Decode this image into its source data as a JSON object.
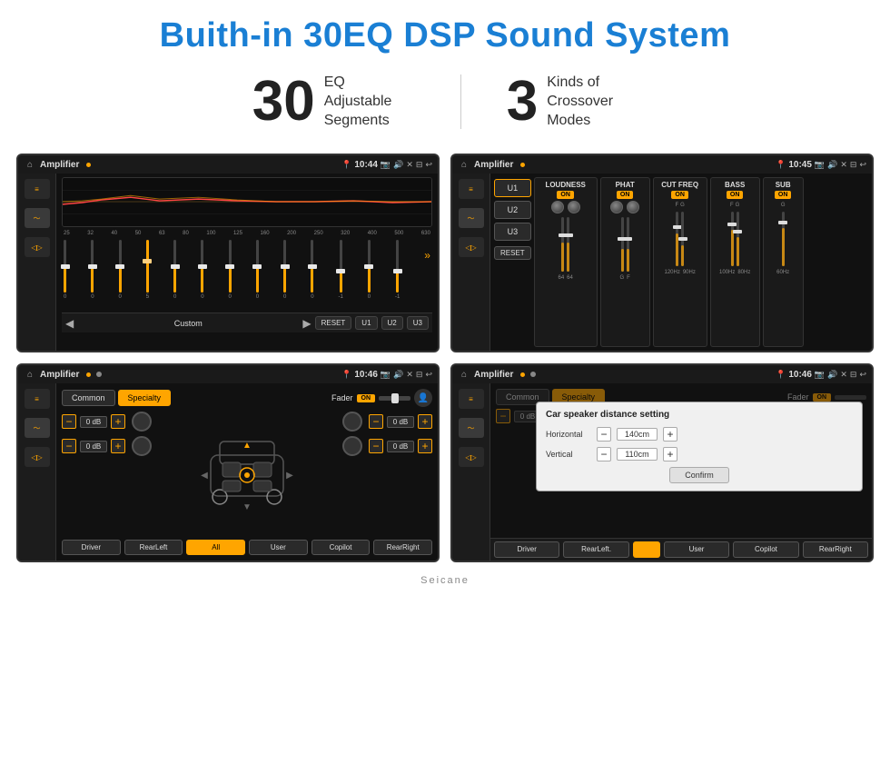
{
  "header": {
    "title": "Buith-in 30EQ DSP Sound System"
  },
  "stats": [
    {
      "number": "30",
      "desc_line1": "EQ Adjustable",
      "desc_line2": "Segments"
    },
    {
      "number": "3",
      "desc_line1": "Kinds of",
      "desc_line2": "Crossover Modes"
    }
  ],
  "screens": [
    {
      "id": "screen1",
      "topbar": {
        "title": "Amplifier",
        "time": "10:44"
      },
      "type": "eq",
      "freq_labels": [
        "25",
        "32",
        "40",
        "50",
        "63",
        "80",
        "100",
        "125",
        "160",
        "200",
        "250",
        "320",
        "400",
        "500",
        "630"
      ],
      "sliders": [
        {
          "val": "0",
          "pos": 50
        },
        {
          "val": "0",
          "pos": 50
        },
        {
          "val": "0",
          "pos": 50
        },
        {
          "val": "5",
          "pos": 60
        },
        {
          "val": "0",
          "pos": 50
        },
        {
          "val": "0",
          "pos": 50
        },
        {
          "val": "0",
          "pos": 50
        },
        {
          "val": "0",
          "pos": 50
        },
        {
          "val": "0",
          "pos": 50
        },
        {
          "val": "0",
          "pos": 50
        },
        {
          "val": "-1",
          "pos": 45
        },
        {
          "val": "0",
          "pos": 50
        },
        {
          "val": "-1",
          "pos": 45
        }
      ],
      "bottom": {
        "preset": "Custom",
        "reset_label": "RESET",
        "u1_label": "U1",
        "u2_label": "U2",
        "u3_label": "U3"
      }
    },
    {
      "id": "screen2",
      "topbar": {
        "title": "Amplifier",
        "time": "10:45"
      },
      "type": "dsp",
      "u_buttons": [
        "U1",
        "U2",
        "U3"
      ],
      "channels": [
        {
          "label": "LOUDNESS",
          "on": true,
          "knobs": 2,
          "freq": ""
        },
        {
          "label": "PHAT",
          "on": true,
          "knobs": 2,
          "freq": ""
        },
        {
          "label": "CUT FREQ",
          "on": true,
          "knobs": 2,
          "freq": "120Hz"
        },
        {
          "label": "BASS",
          "on": true,
          "knobs": 2,
          "freq": "100Hz"
        },
        {
          "label": "SUB",
          "on": true,
          "knobs": 1,
          "freq": "60Hz"
        }
      ],
      "reset_label": "RESET"
    },
    {
      "id": "screen3",
      "topbar": {
        "title": "Amplifier",
        "time": "10:46"
      },
      "type": "speaker",
      "tabs": [
        "Common",
        "Specialty"
      ],
      "active_tab": "Specialty",
      "fader_label": "Fader",
      "on_label": "ON",
      "db_values": [
        "0 dB",
        "0 dB",
        "0 dB",
        "0 dB"
      ],
      "bottom_buttons": [
        "Driver",
        "RearLeft",
        "All",
        "User",
        "Copilot",
        "RearRight"
      ]
    },
    {
      "id": "screen4",
      "topbar": {
        "title": "Amplifier",
        "time": "10:46"
      },
      "type": "speaker_dist",
      "tabs": [
        "Common",
        "Specialty"
      ],
      "active_tab": "Specialty",
      "dialog": {
        "title": "Car speaker distance setting",
        "horizontal_label": "Horizontal",
        "horizontal_value": "140cm",
        "vertical_label": "Vertical",
        "vertical_value": "110cm",
        "confirm_label": "Confirm"
      },
      "db_values": [
        "0 dB",
        "0 dB"
      ],
      "bottom_buttons": [
        "Driver",
        "RearLeft.",
        "User",
        "Copilot",
        "RearRight"
      ]
    }
  ],
  "watermark": "Seicane"
}
